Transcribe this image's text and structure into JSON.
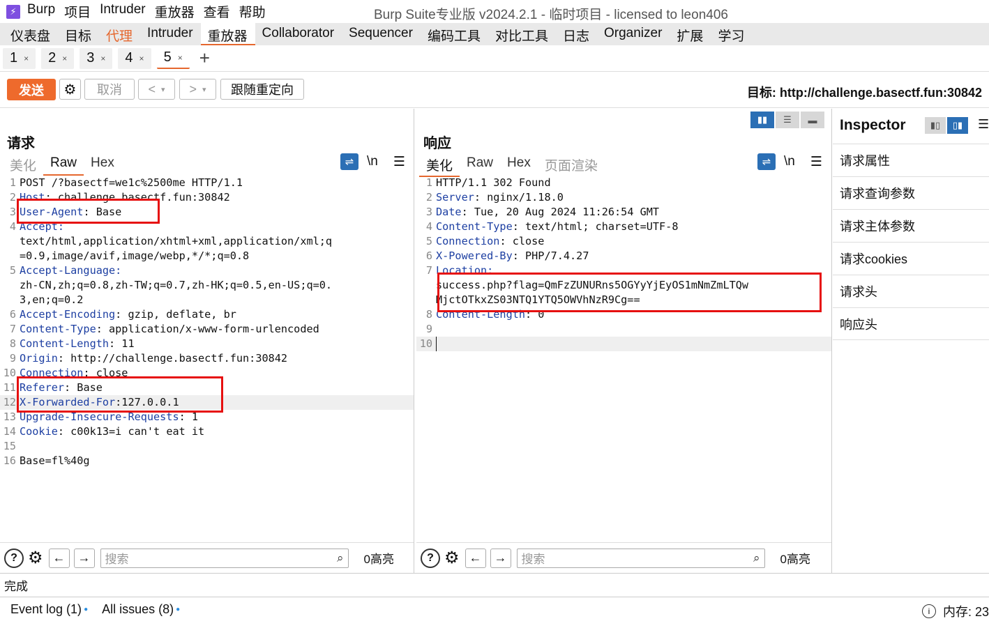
{
  "app": {
    "name": "Burp",
    "menu": [
      "项目",
      "Intruder",
      "重放器",
      "查看",
      "帮助"
    ],
    "window_title": "Burp Suite专业版  v2024.2.1 - 临时项目 - licensed to leon406"
  },
  "main_tabs": [
    "仪表盘",
    "目标",
    "代理",
    "Intruder",
    "重放器",
    "Collaborator",
    "Sequencer",
    "编码工具",
    "对比工具",
    "日志",
    "Organizer",
    "扩展",
    "学习"
  ],
  "repeater_tabs": [
    "1",
    "2",
    "3",
    "4",
    "5"
  ],
  "toolbar": {
    "send": "发送",
    "cancel": "取消",
    "back": "<",
    "forward": ">",
    "follow_redirect": "跟随重定向",
    "target": "目标: http://challenge.basectf.fun:30842"
  },
  "request": {
    "title": "请求",
    "tabs": [
      "美化",
      "Raw",
      "Hex"
    ],
    "newline_label": "\\n",
    "lines": [
      {
        "n": "1",
        "text": "POST /?basectf=we1c%2500me HTTP/1.1"
      },
      {
        "n": "2",
        "text": "Host: challenge.basectf.fun:30842"
      },
      {
        "n": "3",
        "text": "User-Agent: Base"
      },
      {
        "n": "4",
        "text": "Accept:"
      },
      {
        "n": "",
        "text": "text/html,application/xhtml+xml,application/xml;q"
      },
      {
        "n": "",
        "text": "=0.9,image/avif,image/webp,*/*;q=0.8"
      },
      {
        "n": "5",
        "text": "Accept-Language:"
      },
      {
        "n": "",
        "text": "zh-CN,zh;q=0.8,zh-TW;q=0.7,zh-HK;q=0.5,en-US;q=0."
      },
      {
        "n": "",
        "text": "3,en;q=0.2"
      },
      {
        "n": "6",
        "text": "Accept-Encoding: gzip, deflate, br"
      },
      {
        "n": "7",
        "text": "Content-Type: application/x-www-form-urlencoded"
      },
      {
        "n": "8",
        "text": "Content-Length: 11"
      },
      {
        "n": "9",
        "text": "Origin: http://challenge.basectf.fun:30842"
      },
      {
        "n": "10",
        "text": "Connection: close"
      },
      {
        "n": "11",
        "text": "Referer: Base"
      },
      {
        "n": "12",
        "text": "X-Forwarded-For:127.0.0.1"
      },
      {
        "n": "13",
        "text": "Upgrade-Insecure-Requests: 1"
      },
      {
        "n": "14",
        "text": "Cookie: c00k13=i can't eat it"
      },
      {
        "n": "15",
        "text": ""
      },
      {
        "n": "16",
        "text": "Base=fl%40g"
      }
    ],
    "search_placeholder": "搜索",
    "highlights": "0高亮"
  },
  "response": {
    "title": "响应",
    "tabs": [
      "美化",
      "Raw",
      "Hex",
      "页面渲染"
    ],
    "newline_label": "\\n",
    "lines": [
      {
        "n": "1",
        "text": "HTTP/1.1 302 Found"
      },
      {
        "n": "2",
        "text": "Server: nginx/1.18.0"
      },
      {
        "n": "3",
        "text": "Date: Tue, 20 Aug 2024 11:26:54 GMT"
      },
      {
        "n": "4",
        "text": "Content-Type: text/html; charset=UTF-8"
      },
      {
        "n": "5",
        "text": "Connection: close"
      },
      {
        "n": "6",
        "text": "X-Powered-By: PHP/7.4.27"
      },
      {
        "n": "7",
        "text": "Location:"
      },
      {
        "n": "",
        "text": "success.php?flag=QmFzZUNURns5OGYyYjEyOS1mNmZmLTQw"
      },
      {
        "n": "",
        "text": "MjctOTkxZS03NTQ1YTQ5OWVhNzR9Cg=="
      },
      {
        "n": "8",
        "text": "Content-Length: 0"
      },
      {
        "n": "9",
        "text": ""
      },
      {
        "n": "10",
        "text": ""
      }
    ],
    "search_placeholder": "搜索",
    "highlights": "0高亮"
  },
  "inspector": {
    "title": "Inspector",
    "items": [
      "请求属性",
      "请求查询参数",
      "请求主体参数",
      "请求cookies",
      "请求头",
      "响应头"
    ]
  },
  "status": "完成",
  "footer": {
    "event_log": "Event log (1)",
    "all_issues": "All issues (8)",
    "memory": "内存: 23"
  }
}
